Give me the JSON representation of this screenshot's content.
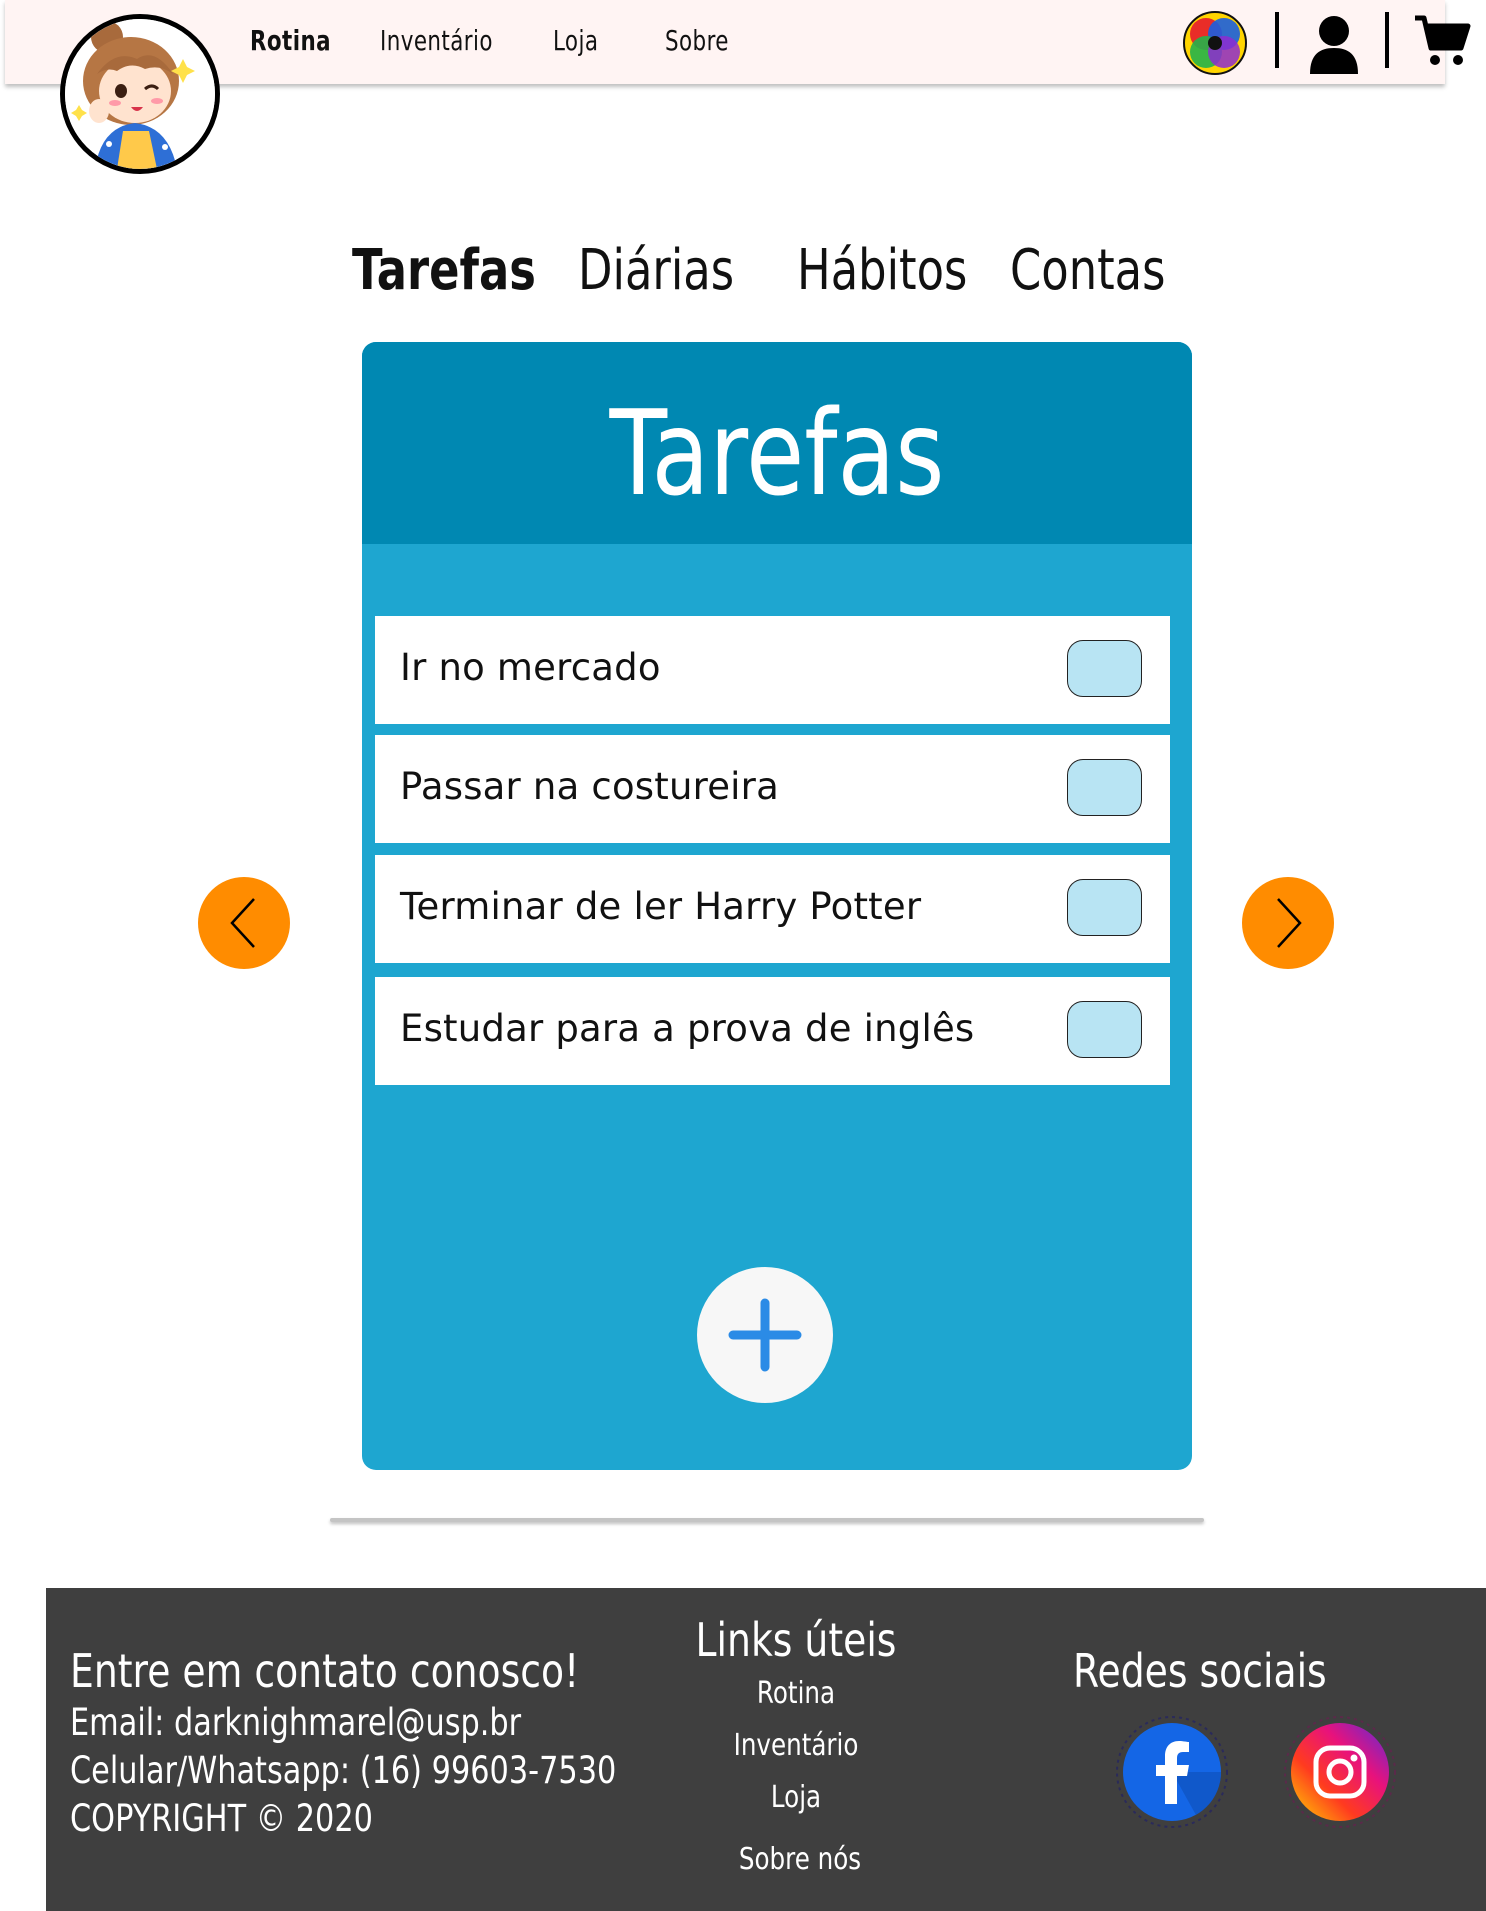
{
  "navbar": {
    "links": [
      "Rotina",
      "Inventário",
      "Loja",
      "Sobre"
    ],
    "active": "Rotina",
    "icons": [
      "color-palette-icon",
      "user-icon",
      "cart-icon"
    ]
  },
  "tabs": [
    {
      "label": "Tarefas",
      "active": true
    },
    {
      "label": "Diárias",
      "active": false
    },
    {
      "label": "Hábitos",
      "active": false
    },
    {
      "label": "Contas",
      "active": false
    }
  ],
  "panel": {
    "title": "Tarefas",
    "tasks": [
      {
        "label": "Ir no mercado",
        "checked": false
      },
      {
        "label": "Passar na costureira",
        "checked": false
      },
      {
        "label": "Terminar de ler Harry Potter",
        "checked": false
      },
      {
        "label": "Estudar para a prova de inglês",
        "checked": false
      }
    ]
  },
  "footer": {
    "contact": {
      "heading": "Entre em contato conosco!",
      "email": "Email: darknighmarel@usp.br",
      "phone": "Celular/Whatsapp: (16) 99603-7530",
      "copyright": "COPYRIGHT © 2020"
    },
    "links": {
      "heading": "Links úteis",
      "items": [
        "Rotina",
        "Inventário",
        "Loja",
        "Sobre nós"
      ]
    },
    "social": {
      "heading": "Redes sociais",
      "items": [
        "facebook-icon",
        "instagram-icon"
      ]
    }
  },
  "colors": {
    "panel": "#1ea6d0",
    "panel_header": "#0088b2",
    "checkbox": "#b8e4f3",
    "arrow": "#ff8c00",
    "footer": "#3f3f3f",
    "navbar": "#fff4f3"
  }
}
